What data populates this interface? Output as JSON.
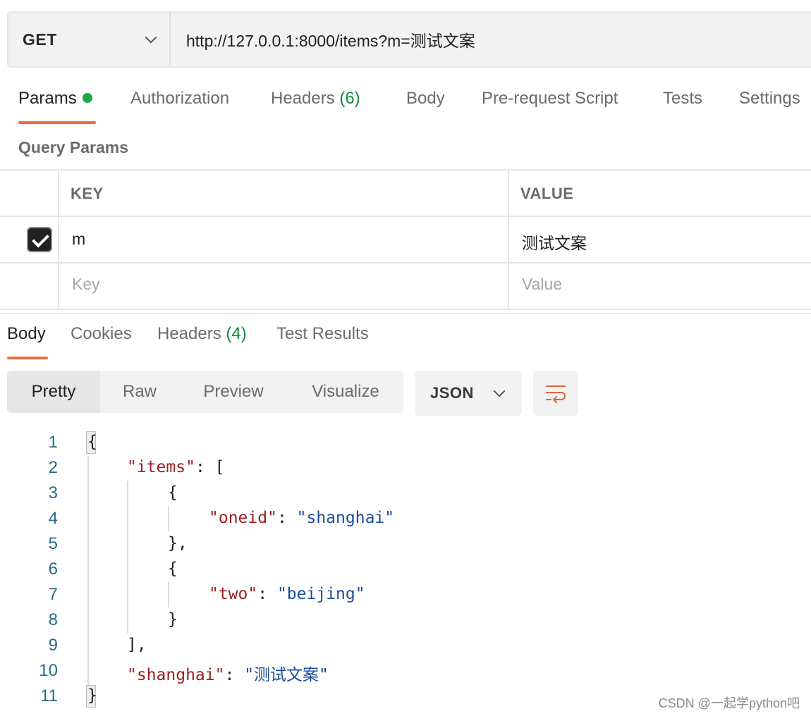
{
  "request": {
    "method": "GET",
    "url": "http://127.0.0.1:8000/items?m=测试文案"
  },
  "request_tabs": {
    "params": "Params",
    "authorization": "Authorization",
    "headers": "Headers",
    "headers_count": "(6)",
    "body": "Body",
    "prerequest": "Pre-request Script",
    "tests": "Tests",
    "settings": "Settings"
  },
  "query_params": {
    "title": "Query Params",
    "col_key": "KEY",
    "col_value": "VALUE",
    "rows": [
      {
        "checked": true,
        "key": "m",
        "value": "测试文案"
      }
    ],
    "placeholder_key": "Key",
    "placeholder_value": "Value"
  },
  "response_tabs": {
    "body": "Body",
    "cookies": "Cookies",
    "headers": "Headers",
    "headers_count": "(4)",
    "test_results": "Test Results"
  },
  "view_modes": [
    "Pretty",
    "Raw",
    "Preview",
    "Visualize"
  ],
  "active_view": "Pretty",
  "format": "JSON",
  "code": {
    "line_numbers": [
      "1",
      "2",
      "3",
      "4",
      "5",
      "6",
      "7",
      "8",
      "9",
      "10",
      "11"
    ],
    "open_brace": "{",
    "items_key": "\"items\"",
    "items_sep": ": [",
    "obj_open": "{",
    "oneid_key": "\"oneid\"",
    "colon": ": ",
    "oneid_val": "\"shanghai\"",
    "obj_close_comma": "},",
    "two_key": "\"two\"",
    "two_val": "\"beijing\"",
    "obj_close": "}",
    "arr_close": "],",
    "shanghai_key": "\"shanghai\"",
    "shanghai_val": "\"测试文案\"",
    "close_brace": "}"
  },
  "watermark": "CSDN @一起学python吧",
  "colors": {
    "accent": "#ee6e41",
    "green": "#0f8a3c",
    "key": "#9c1f1f",
    "string": "#1c4c9c"
  }
}
